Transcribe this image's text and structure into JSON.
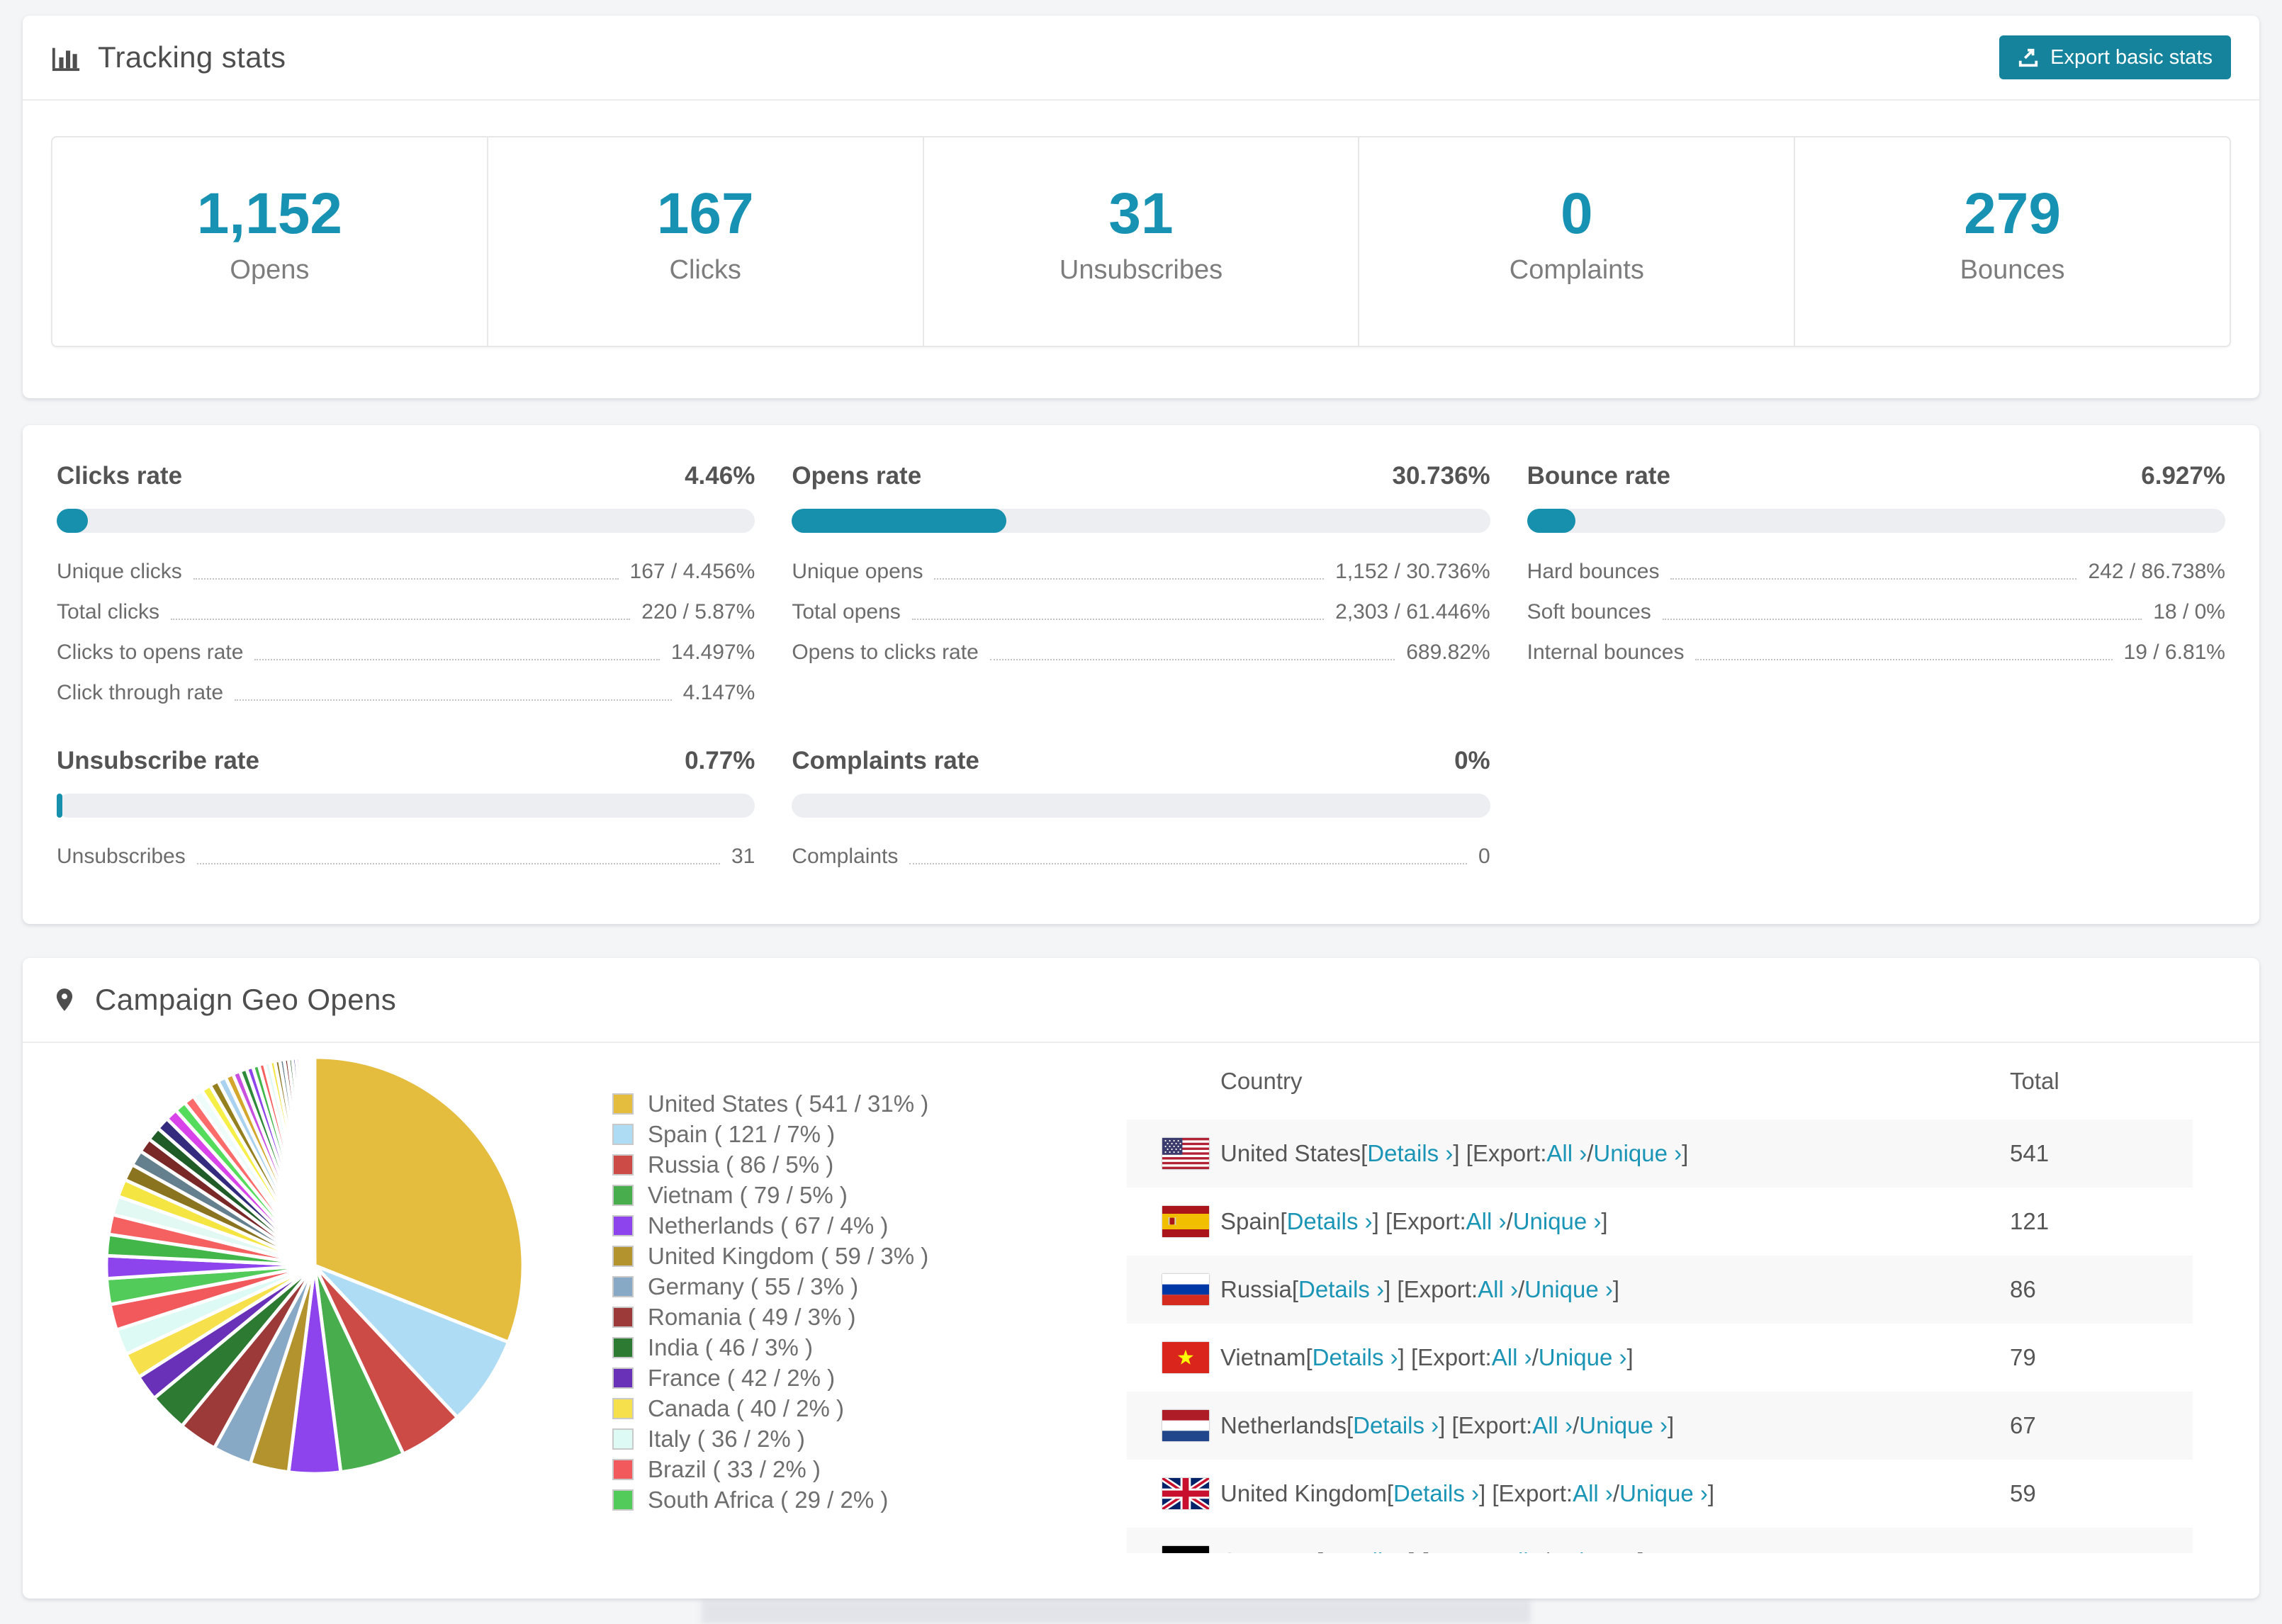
{
  "colors": {
    "accent": "#1792b2",
    "button": "#15839c",
    "link": "#1b95b5",
    "bar_track": "#eceef2",
    "page_background": "#f4f5f7"
  },
  "tracking": {
    "title": "Tracking stats",
    "export_button_label": "Export basic stats",
    "summary": [
      {
        "value": "1,152",
        "label": "Opens"
      },
      {
        "value": "167",
        "label": "Clicks"
      },
      {
        "value": "31",
        "label": "Unsubscribes"
      },
      {
        "value": "0",
        "label": "Complaints"
      },
      {
        "value": "279",
        "label": "Bounces"
      }
    ]
  },
  "rates": {
    "blocks": [
      {
        "title": "Clicks rate",
        "value": "4.46%",
        "pct": 4.46,
        "rows": [
          {
            "label": "Unique clicks",
            "value": "167 / 4.456%"
          },
          {
            "label": "Total clicks",
            "value": "220 / 5.87%"
          },
          {
            "label": "Clicks to opens rate",
            "value": "14.497%"
          },
          {
            "label": "Click through rate",
            "value": "4.147%"
          }
        ]
      },
      {
        "title": "Opens rate",
        "value": "30.736%",
        "pct": 30.736,
        "rows": [
          {
            "label": "Unique opens",
            "value": "1,152 / 30.736%"
          },
          {
            "label": "Total opens",
            "value": "2,303 / 61.446%"
          },
          {
            "label": "Opens to clicks rate",
            "value": "689.82%"
          }
        ]
      },
      {
        "title": "Bounce rate",
        "value": "6.927%",
        "pct": 6.927,
        "rows": [
          {
            "label": "Hard bounces",
            "value": "242 / 86.738%"
          },
          {
            "label": "Soft bounces",
            "value": "18 / 0%"
          },
          {
            "label": "Internal bounces",
            "value": "19 / 6.81%"
          }
        ]
      },
      {
        "title": "Unsubscribe rate",
        "value": "0.77%",
        "pct": 0.77,
        "rows": [
          {
            "label": "Unsubscribes",
            "value": "31"
          }
        ]
      },
      {
        "title": "Complaints rate",
        "value": "0%",
        "pct": 0,
        "rows": [
          {
            "label": "Complaints",
            "value": "0"
          }
        ]
      }
    ]
  },
  "geo": {
    "title": "Campaign Geo Opens",
    "chart_data": {
      "type": "pie",
      "title": "Campaign Geo Opens",
      "legend_position": "right",
      "series": [
        {
          "label": "United States",
          "value": 541,
          "pct": 31,
          "color": "#e4bc3e"
        },
        {
          "label": "Spain",
          "value": 121,
          "pct": 7,
          "color": "#aedcf4"
        },
        {
          "label": "Russia",
          "value": 86,
          "pct": 5,
          "color": "#cc4b46"
        },
        {
          "label": "Vietnam",
          "value": 79,
          "pct": 5,
          "color": "#47ad4d"
        },
        {
          "label": "Netherlands",
          "value": 67,
          "pct": 4,
          "color": "#8e44ec"
        },
        {
          "label": "United Kingdom",
          "value": 59,
          "pct": 3,
          "color": "#b2932e"
        },
        {
          "label": "Germany",
          "value": 55,
          "pct": 3,
          "color": "#87a9c5"
        },
        {
          "label": "Romania",
          "value": 49,
          "pct": 3,
          "color": "#9c3a3a"
        },
        {
          "label": "India",
          "value": 46,
          "pct": 3,
          "color": "#2d7a33"
        },
        {
          "label": "France",
          "value": 42,
          "pct": 2,
          "color": "#6930b8"
        },
        {
          "label": "Canada",
          "value": 40,
          "pct": 2,
          "color": "#f6e04b"
        },
        {
          "label": "Italy",
          "value": 36,
          "pct": 2,
          "color": "#defaf4"
        },
        {
          "label": "Brazil",
          "value": 33,
          "pct": 2,
          "color": "#f2595c"
        },
        {
          "label": "South Africa",
          "value": 29,
          "pct": 2,
          "color": "#53cb5a"
        }
      ],
      "others_pct": 26
    },
    "table": {
      "columns": [
        "Country",
        "Total"
      ],
      "link_labels": {
        "details": "Details ›",
        "export": "Export:",
        "all": "All ›",
        "unique": "Unique ›"
      },
      "rows": [
        {
          "country": "United States",
          "flag": "us",
          "total": "541"
        },
        {
          "country": "Spain",
          "flag": "es",
          "total": "121"
        },
        {
          "country": "Russia",
          "flag": "ru",
          "total": "86"
        },
        {
          "country": "Vietnam",
          "flag": "vn",
          "total": "79"
        },
        {
          "country": "Netherlands",
          "flag": "nl",
          "total": "67"
        },
        {
          "country": "United Kingdom",
          "flag": "gb",
          "total": "59"
        },
        {
          "country": "Germany",
          "flag": "de",
          "total": ""
        }
      ]
    }
  }
}
